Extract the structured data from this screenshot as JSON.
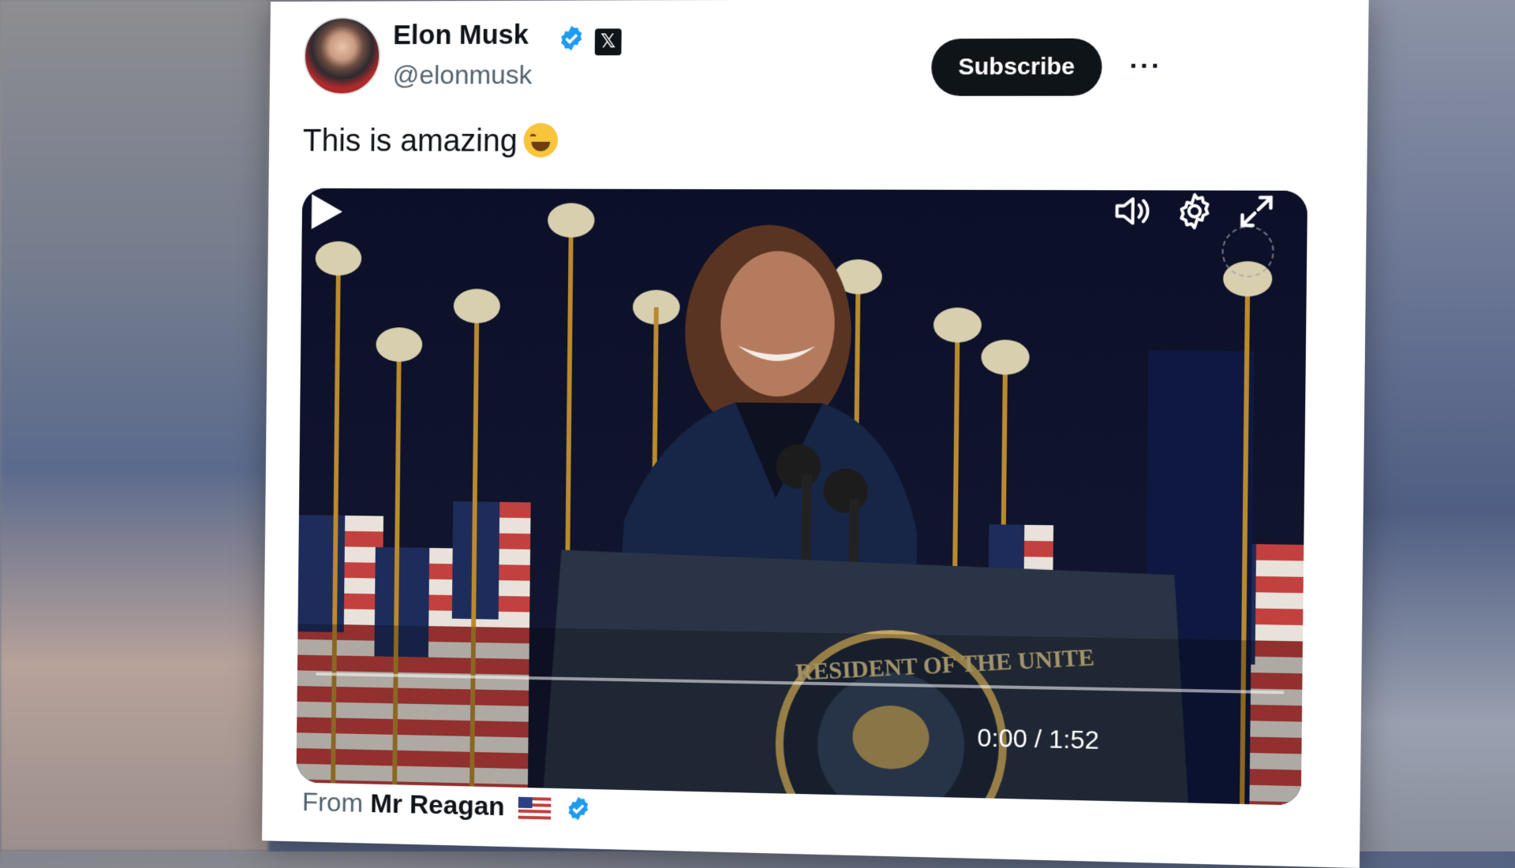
{
  "post": {
    "author_name": "Elon Musk",
    "author_handle": "@elonmusk",
    "subscribe_label": "Subscribe",
    "more_label": "···",
    "text": "This is amazing",
    "emoji": "face-with-tears-of-joy-icon"
  },
  "video": {
    "time_display": "0:00 / 1:52",
    "progress": 0.0,
    "seal_text": "RESIDENT OF THE UNITE"
  },
  "footer": {
    "from_label": "From",
    "source_name": "Mr Reagan"
  },
  "colors": {
    "text_primary": "#0f1419",
    "text_secondary": "#536471",
    "verified_blue": "#1d9bf0",
    "button_black": "#0f1419"
  }
}
